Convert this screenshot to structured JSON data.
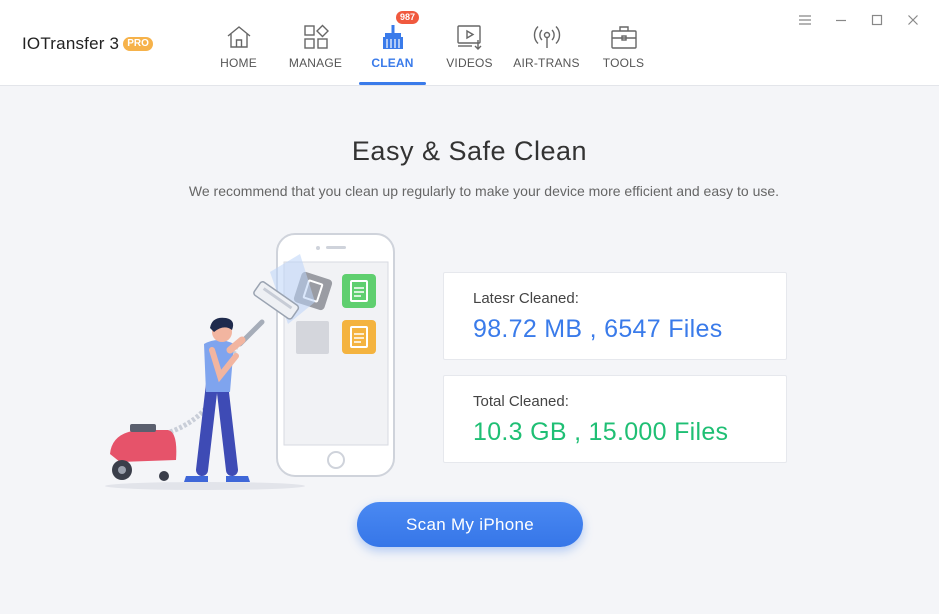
{
  "app": {
    "name": "IOTransfer 3",
    "badge": "PRO"
  },
  "nav": {
    "items": [
      {
        "label": "HOME",
        "icon": "home-icon"
      },
      {
        "label": "MANAGE",
        "icon": "manage-icon"
      },
      {
        "label": "CLEAN",
        "icon": "broom-icon",
        "badge": "987",
        "active": true
      },
      {
        "label": "VIDEOS",
        "icon": "video-download-icon"
      },
      {
        "label": "AIR-TRANS",
        "icon": "wireless-icon"
      },
      {
        "label": "TOOLS",
        "icon": "toolbox-icon"
      }
    ]
  },
  "window_controls": [
    "menu-icon",
    "minimize-icon",
    "maximize-icon",
    "close-icon"
  ],
  "main": {
    "title": "Easy & Safe Clean",
    "subtitle": "We recommend that you clean up regularly to make your device more efficient and easy to use.",
    "latest": {
      "label": "Latesr Cleaned:",
      "value": "98.72 MB , 6547 Files"
    },
    "total": {
      "label": "Total Cleaned:",
      "value": "10.3 GB , 15.000 Files"
    },
    "scan_button": "Scan My iPhone"
  },
  "colors": {
    "accent": "#3a7bea",
    "success": "#1fbf74",
    "badge": "#f0593e",
    "pro": "#f6b24a"
  }
}
